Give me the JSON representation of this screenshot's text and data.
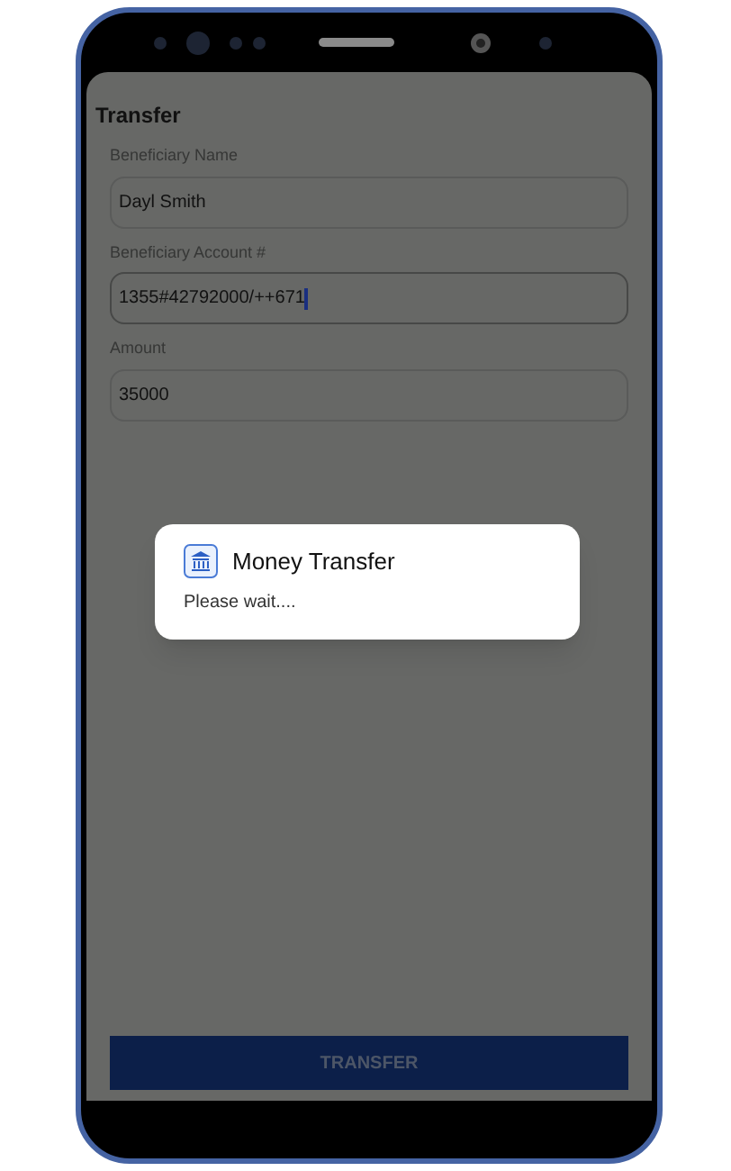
{
  "screen": {
    "title": "Transfer"
  },
  "fields": [
    {
      "label": "Beneficiary Name",
      "value": "Dayl Smith",
      "focused": false
    },
    {
      "label": "Beneficiary Account #",
      "value": "1355#42792000/++671",
      "focused": true
    },
    {
      "label": "Amount",
      "value": "35000",
      "focused": false
    }
  ],
  "button": {
    "label": "TRANSFER"
  },
  "dialog": {
    "title": "Money Transfer",
    "message": "Please wait...."
  }
}
